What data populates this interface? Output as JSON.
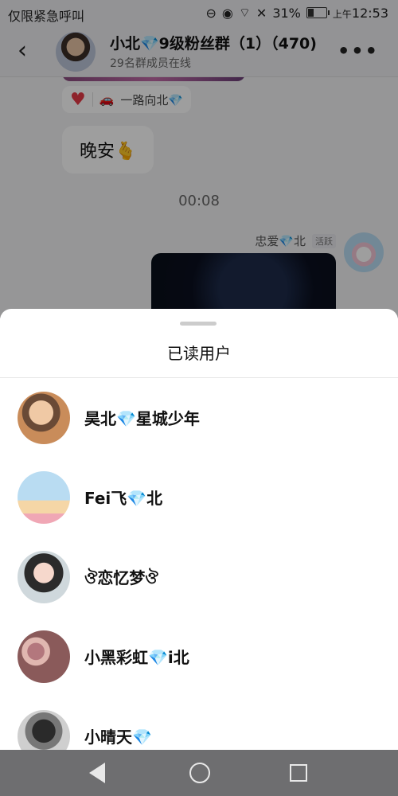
{
  "status_bar": {
    "left_text": "仅限紧急呼叫",
    "battery_percent": "31%",
    "time_prefix": "上午",
    "time": "12:53"
  },
  "header": {
    "group_name": "小北💎9级粉丝群（1）（470)",
    "online_text": "29名群成员在线",
    "more_icon": "more-icon",
    "back_icon": "back-chevron-icon"
  },
  "chat": {
    "reaction_user": "一路向北💎",
    "message_text": "晚安🫰",
    "timestamp": "00:08",
    "sender_nick": "忠爱💎北",
    "sender_tag": "活跃"
  },
  "sheet": {
    "title": "已读用户",
    "readers": [
      {
        "name": "昊北💎星城少年"
      },
      {
        "name": "Fei飞💎北"
      },
      {
        "name": "ঔ恋忆梦ঔ"
      },
      {
        "name": "小黑彩虹💎i北"
      },
      {
        "name": "小晴天💎"
      }
    ]
  },
  "navbar": {
    "back": "nav-back-triangle-icon",
    "home": "nav-home-circle-icon",
    "recents": "nav-recents-square-icon"
  }
}
